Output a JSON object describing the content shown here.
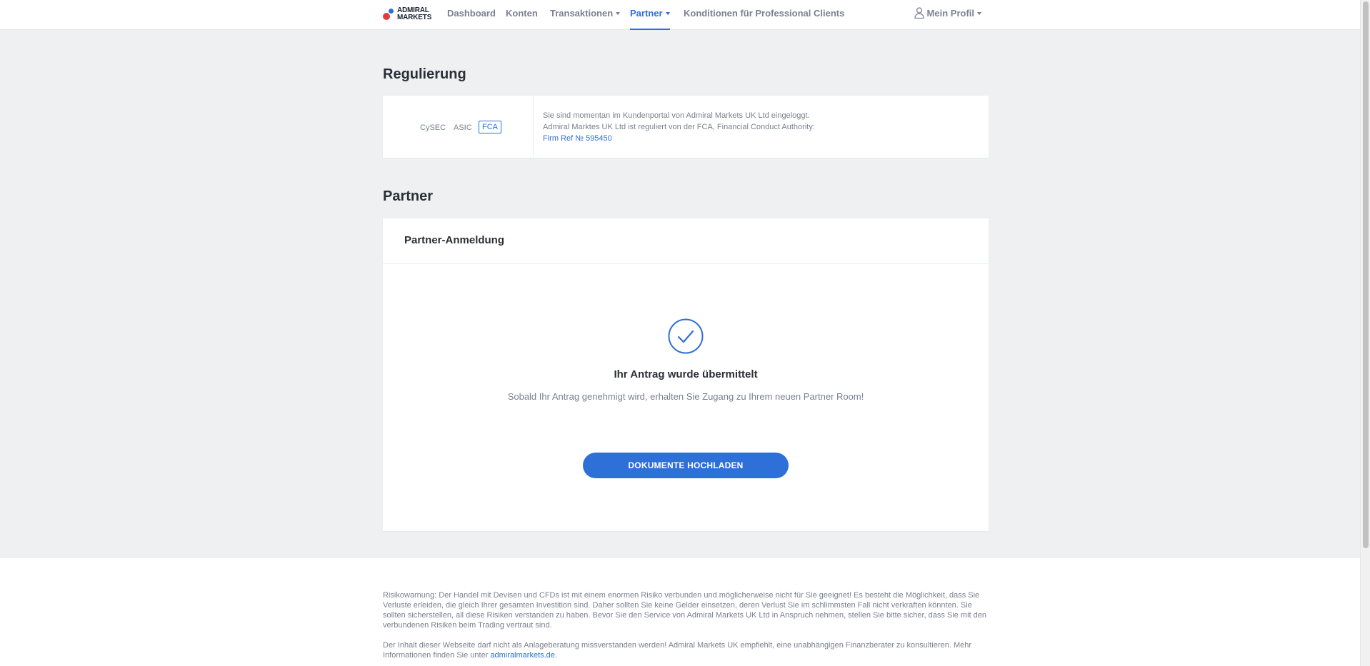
{
  "nav": {
    "logo_text": "ADMIRAL\nMARKETS",
    "items": [
      {
        "label": "Dashboard"
      },
      {
        "label": "Konten"
      },
      {
        "label": "Transaktionen"
      },
      {
        "label": "Partner"
      },
      {
        "label": "Konditionen für Professional Clients"
      }
    ],
    "profile_label": "Mein Profil",
    "accent": "#2f6fd8"
  },
  "regulation": {
    "title": "Regulierung",
    "tabs": [
      "CySEC",
      "ASIC",
      "FCA"
    ],
    "selected": "FCA",
    "line1": "Sie sind momentan im Kundenportal von Admiral Markets UK Ltd eingeloggt.",
    "line2": "Admiral Marktes UK Ltd ist reguliert von der FCA, Financial Conduct Authority:",
    "firm_ref": "Firm Ref № 595450"
  },
  "partner": {
    "title": "Partner",
    "card_header": "Partner-Anmeldung",
    "success_title": "Ihr Antrag wurde übermittelt",
    "success_text": "Sobald Ihr Antrag genehmigt wird, erhalten Sie Zugang zu Ihrem neuen Partner Room!",
    "button_label": "DOKUMENTE HOCHLADEN"
  },
  "footer": {
    "risk_warning": "Risikowarnung: Der Handel mit Devisen und CFDs ist mit einem enormen Risiko verbunden und möglicherweise nicht für Sie geeignet! Es besteht die Möglichkeit, dass Sie Verluste erleiden, die gleich Ihrer gesamten Investition sind. Daher sollten Sie keine Gelder einsetzen, deren Verlust Sie im schlimmsten Fall nicht verkraften könnten. Sie sollten sicherstellen, all diese Risiken verstanden zu haben. Bevor Sie den Service von Admiral Markets UK Ltd in Anspruch nehmen, stellen Sie bitte sicher, dass Sie mit den verbundenen Risiken beim Trading vertraut sind.",
    "disclaimer_prefix": "Der Inhalt dieser Webseite darf nicht als Anlageberatung missverstanden werden! Admiral Markets UK empfiehlt, eine unabhängigen Finanzberater zu konsultieren. Mehr Informationen finden Sie unter ",
    "disclaimer_link": "admiralmarkets.de",
    "disclaimer_suffix": "."
  }
}
